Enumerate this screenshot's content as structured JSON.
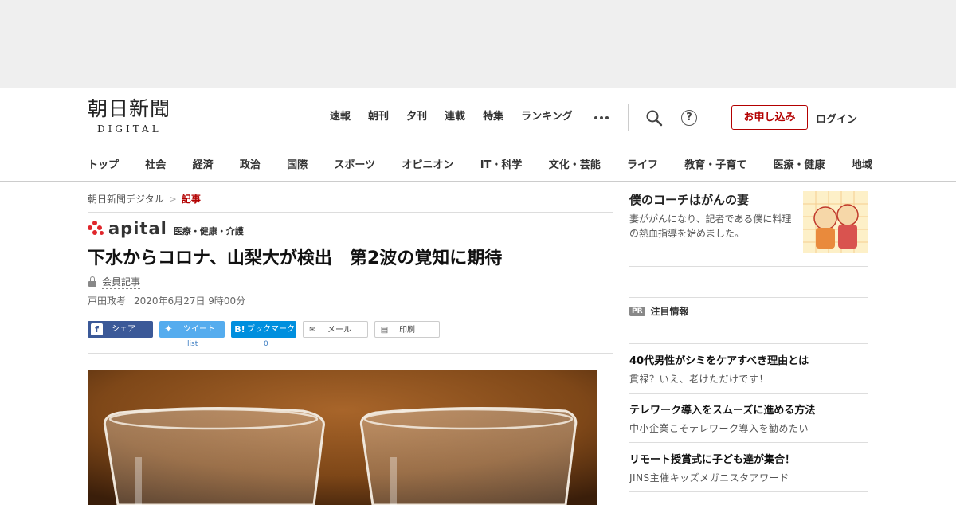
{
  "header": {
    "logo_main": "朝日新聞",
    "logo_sub": "DIGITAL",
    "top_nav": [
      "速報",
      "朝刊",
      "夕刊",
      "連載",
      "特集",
      "ランキング"
    ],
    "more_icon": "more-dots-icon",
    "search_icon": "search-icon",
    "help_glyph": "?",
    "signup_label": "お申し込み",
    "login_label": "ログイン",
    "accent_color": "#b30000"
  },
  "categories": [
    "トップ",
    "社会",
    "経済",
    "政治",
    "国際",
    "スポーツ",
    "オピニオン",
    "IT・科学",
    "文化・芸能",
    "ライフ",
    "教育・子育て",
    "医療・健康",
    "地域"
  ],
  "breadcrumb": {
    "home": "朝日新聞デジタル",
    "separator": ">",
    "current": "記事"
  },
  "article": {
    "brand": "apital",
    "brand_tag": "医療・健康・介護",
    "headline": "下水からコロナ、山梨大が検出　第2波の覚知に期待",
    "member_label": "会員記事",
    "author": "戸田政考",
    "date": "2020年6月27日 9時00分"
  },
  "share": {
    "facebook": "シェア",
    "twitter": "ツイート",
    "twitter_count": "list",
    "hatena": "ブックマーク",
    "hatena_count": "0",
    "mail": "メール",
    "print": "印刷"
  },
  "sidebar": {
    "feature": {
      "title": "僕のコーチはがんの妻",
      "desc": "妻ががんになり、記者である僕に料理の熱血指導を始めました。"
    },
    "pr_badge": "PR",
    "pr_label": "注目情報",
    "pr_items": [
      {
        "title": "40代男性がシミをケアすべき理由とは",
        "sub": "貫禄？いえ、老けただけです！"
      },
      {
        "title": "テレワーク導入をスムーズに進める方法",
        "sub": "中小企業こそテレワーク導入を勧めたい"
      },
      {
        "title": "リモート授賞式に子ども達が集合！",
        "sub": "JINS主催キッズメガニスタアワード"
      }
    ]
  }
}
